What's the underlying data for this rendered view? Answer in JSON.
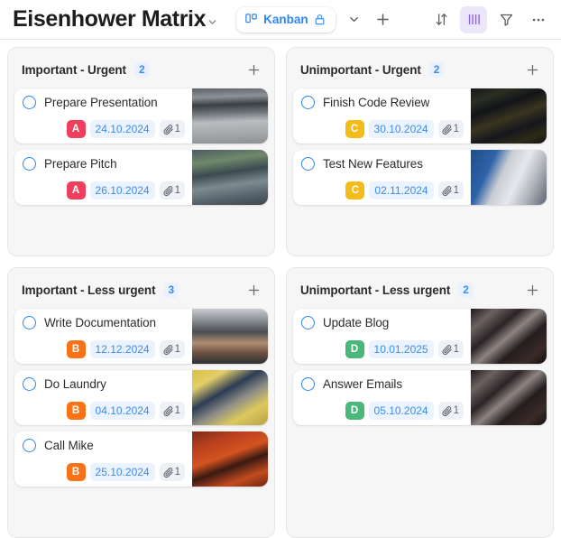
{
  "header": {
    "title": "Eisenhower Matrix",
    "title_chevron_icon": "chevron-down-icon",
    "view": {
      "board_icon": "kanban-board-icon",
      "label": "Kanban",
      "lock_icon": "lock-icon"
    },
    "view_chevron_icon": "chevron-down-icon",
    "add_view_icon": "plus-icon",
    "tools": [
      {
        "name": "sort",
        "icon": "sort-arrows-icon",
        "active": false
      },
      {
        "name": "columns",
        "icon": "columns-icon",
        "active": true
      },
      {
        "name": "filter",
        "icon": "filter-funnel-icon",
        "active": false
      },
      {
        "name": "more",
        "icon": "ellipsis-icon",
        "active": false
      }
    ]
  },
  "colors": {
    "accent_blue": "#2b87f5",
    "prio_a": "#ef3f5c",
    "prio_b": "#f97316",
    "prio_c": "#f5bb19",
    "prio_d": "#4ab87a",
    "active_tool": "#8b5cf6",
    "column_bg": "#f6f6f6",
    "date_chip_bg": "#eaf3fe"
  },
  "columns": [
    {
      "id": "important-urgent",
      "title": "Important  -  Urgent",
      "count": "2",
      "add_icon": "plus-icon",
      "cards": [
        {
          "title": "Prepare Presentation",
          "checkbox_icon": "circle-checkbox-icon",
          "priority": "A",
          "priority_color": "#ef3f5c",
          "date": "24.10.2024",
          "attachment_icon": "paperclip-icon",
          "attachments": "1",
          "thumb": "office-interior-photo",
          "thumb_css": "linear-gradient(178deg,#5c6168 0%,#8d9299 16%,#3a3f45 30%,#6d7278 44%,#b9bcbf 60%,#a8abae 78%,#8e9194 100%)"
        },
        {
          "title": "Prepare Pitch",
          "checkbox_icon": "circle-checkbox-icon",
          "priority": "A",
          "priority_color": "#ef3f5c",
          "date": "26.10.2024",
          "attachment_icon": "paperclip-icon",
          "attachments": "1",
          "thumb": "two-people-meeting-outdoors-photo",
          "thumb_css": "linear-gradient(172deg,#4d5a63 0%,#6f8a6a 22%,#3d4a52 42%,#7d8a91 62%,#56626b 82%,#3c464d 100%)"
        }
      ]
    },
    {
      "id": "unimportant-urgent",
      "title": "Unimportant  -  Urgent",
      "count": "2",
      "add_icon": "plus-icon",
      "cards": [
        {
          "title": "Finish Code Review",
          "checkbox_icon": "circle-checkbox-icon",
          "priority": "C",
          "priority_color": "#f5bb19",
          "date": "30.10.2024",
          "attachment_icon": "paperclip-icon",
          "attachments": "1",
          "thumb": "code-on-dark-screen-photo",
          "thumb_css": "linear-gradient(160deg,#16181c 0%,#2b2f22 18%,#121418 34%,#3a3520 52%,#15171b 70%,#2e2a18 86%,#101114 100%)"
        },
        {
          "title": "Test New Features",
          "checkbox_icon": "circle-checkbox-icon",
          "priority": "C",
          "priority_color": "#f5bb19",
          "date": "02.11.2024",
          "attachment_icon": "paperclip-icon",
          "attachments": "1",
          "thumb": "person-at-monitor-photo",
          "thumb_css": "linear-gradient(115deg,#1f4d87 0%,#2f63a8 26%,#c9ccd2 42%,#e6e8ec 60%,#aeb3bb 78%,#5b6573 100%)"
        }
      ]
    },
    {
      "id": "important-less-urgent",
      "title": "Important  -  Less urgent",
      "count": "3",
      "add_icon": "plus-icon",
      "cards": [
        {
          "title": "Write Documentation",
          "checkbox_icon": "circle-checkbox-icon",
          "priority": "B",
          "priority_color": "#f97316",
          "date": "12.12.2024",
          "attachment_icon": "paperclip-icon",
          "attachments": "1",
          "thumb": "hands-typing-on-laptop-photo",
          "thumb_css": "linear-gradient(180deg,#c9ccd0 0%,#8e9398 20%,#4a4d52 42%,#b08c72 62%,#6d5343 80%,#2d3034 100%)"
        },
        {
          "title": "Do Laundry",
          "checkbox_icon": "circle-checkbox-icon",
          "priority": "B",
          "priority_color": "#f97316",
          "date": "04.10.2024",
          "attachment_icon": "paperclip-icon",
          "attachments": "1",
          "thumb": "yellow-laundromat-photo",
          "thumb_css": "linear-gradient(150deg,#d9bf44 0%,#e3cf6a 20%,#2c3c55 40%,#8f8f86 58%,#dcc85d 76%,#b8a24a 100%)"
        },
        {
          "title": "Call Mike",
          "checkbox_icon": "circle-checkbox-icon",
          "priority": "B",
          "priority_color": "#f97316",
          "date": "25.10.2024",
          "attachment_icon": "paperclip-icon",
          "attachments": "1",
          "thumb": "red-phone-booth-photo",
          "thumb_css": "linear-gradient(160deg,#7a2b18 0%,#b8401f 22%,#d4531f 44%,#3a1a12 60%,#c24a1e 80%,#6e2714 100%)"
        }
      ]
    },
    {
      "id": "unimportant-less-urgent",
      "title": "Unimportant  -  Less urgent",
      "count": "2",
      "add_icon": "plus-icon",
      "cards": [
        {
          "title": "Update Blog",
          "checkbox_icon": "circle-checkbox-icon",
          "priority": "D",
          "priority_color": "#4ab87a",
          "date": "10.01.2025",
          "attachment_icon": "paperclip-icon",
          "attachments": "1",
          "thumb": "person-with-laptop-dark-room-photo",
          "thumb_css": "linear-gradient(140deg,#20191b 0%,#6b6260 18%,#2b2426 36%,#8d8480 50%,#241d1f 66%,#3a2b26 84%,#141012 100%)"
        },
        {
          "title": "Answer Emails",
          "checkbox_icon": "circle-checkbox-icon",
          "priority": "D",
          "priority_color": "#4ab87a",
          "date": "05.10.2024",
          "attachment_icon": "paperclip-icon",
          "attachments": "1",
          "thumb": "person-with-laptop-dark-room-photo",
          "thumb_css": "linear-gradient(140deg,#20191b 0%,#6b6260 18%,#2b2426 36%,#8d8480 50%,#241d1f 66%,#3a2b26 84%,#141012 100%)"
        }
      ]
    }
  ]
}
